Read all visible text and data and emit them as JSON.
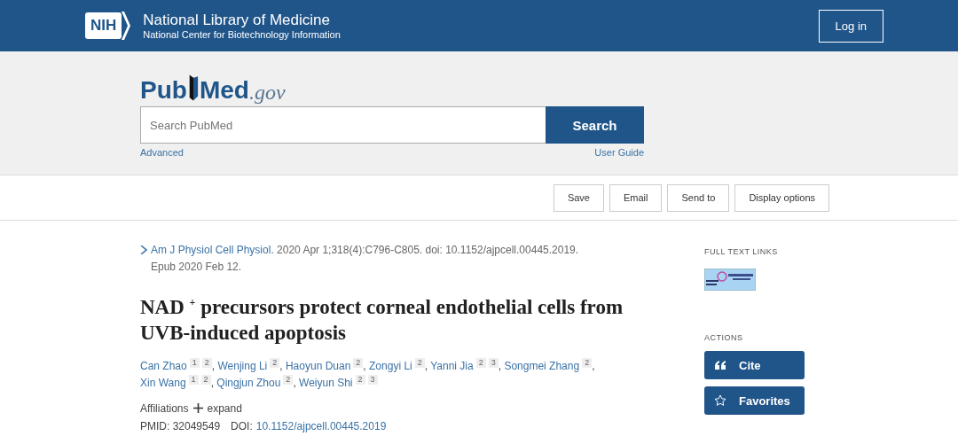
{
  "header": {
    "logo": "NIH",
    "title": "National Library of Medicine",
    "subtitle": "National Center for Biotechnology Information",
    "login": "Log in"
  },
  "search": {
    "logo_parts": [
      "Pub",
      "Med"
    ],
    "logo_suffix": ".gov",
    "placeholder": "Search PubMed",
    "button": "Search",
    "advanced": "Advanced",
    "guide": "User Guide"
  },
  "toolbar": [
    "Save",
    "Email",
    "Send to",
    "Display options"
  ],
  "citation": {
    "journal": "Am J Physiol Cell Physiol.",
    "details": "2020 Apr 1;318(4):C796-C805. doi: 10.1152/ajpcell.00445.2019. Epub 2020 Feb 12."
  },
  "title": "NAD $^{+}$ precursors protect corneal endothelial cells from UVB-induced apoptosis",
  "authors": [
    {
      "name": "Can Zhao",
      "affiliations": [
        "1",
        "2"
      ],
      "separator": ","
    },
    {
      "name": "Wenjing Li",
      "affiliations": [
        "2"
      ],
      "separator": ","
    },
    {
      "name": "Haoyun Duan",
      "affiliations": [
        "2"
      ],
      "separator": ","
    },
    {
      "name": "Zongyi Li",
      "affiliations": [
        "2"
      ],
      "separator": ","
    },
    {
      "name": "Yanni Jia",
      "affiliations": [
        "2",
        "3"
      ],
      "separator": ","
    },
    {
      "name": "Songmei Zhang",
      "affiliations": [
        "2"
      ],
      "separator": ","
    },
    {
      "name": "Xin Wang",
      "affiliations": [
        "1",
        "2"
      ],
      "separator": ","
    },
    {
      "name": "Qingjun Zhou",
      "affiliations": [
        "2"
      ],
      "separator": ","
    },
    {
      "name": "Weiyun Shi",
      "affiliations": [
        "2",
        "3"
      ]
    }
  ],
  "affiliations": {
    "label": "Affiliations",
    "toggle": "expand",
    "expanded": false
  },
  "ids": {
    "pmid_label": "PMID: 32049549",
    "doi_label": "DOI:",
    "doi": "10.1152/ajpcell.00445.2019"
  },
  "sidebar": {
    "full_text_heading": "FULL TEXT LINKS",
    "actions_heading": "ACTIONS",
    "actions": [
      {
        "kind": "cite",
        "label": "Cite"
      },
      {
        "kind": "favorites",
        "label": "Favorites"
      }
    ]
  }
}
